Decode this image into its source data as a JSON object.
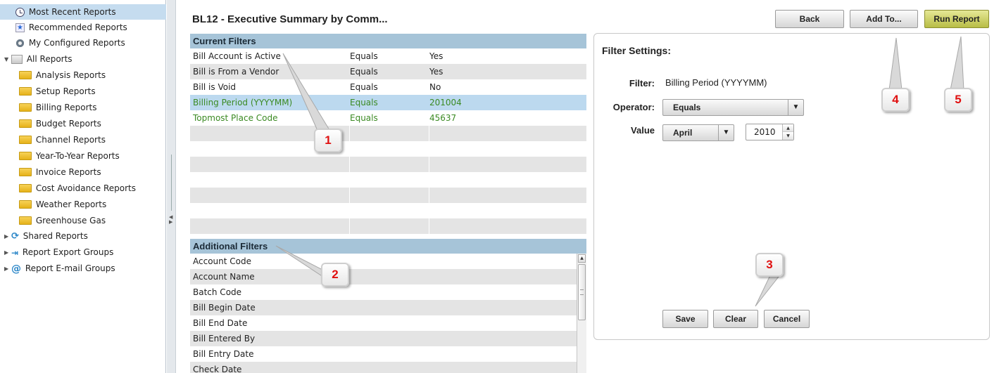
{
  "sidebar": {
    "items": [
      {
        "label": "Most Recent Reports",
        "icon": "clock-icon"
      },
      {
        "label": "Recommended Reports",
        "icon": "star-icon"
      },
      {
        "label": "My Configured Reports",
        "icon": "gear-icon"
      },
      {
        "label": "All Reports",
        "icon": "all-reports-icon"
      },
      {
        "label": "Analysis Reports",
        "icon": "folder-icon"
      },
      {
        "label": "Setup Reports",
        "icon": "folder-icon"
      },
      {
        "label": "Billing Reports",
        "icon": "folder-icon"
      },
      {
        "label": "Budget Reports",
        "icon": "folder-icon"
      },
      {
        "label": "Channel Reports",
        "icon": "folder-icon"
      },
      {
        "label": "Year-To-Year Reports",
        "icon": "folder-icon"
      },
      {
        "label": "Invoice Reports",
        "icon": "folder-icon"
      },
      {
        "label": "Cost Avoidance Reports",
        "icon": "folder-icon"
      },
      {
        "label": "Weather Reports",
        "icon": "folder-icon"
      },
      {
        "label": "Greenhouse Gas",
        "icon": "folder-icon"
      },
      {
        "label": "Shared Reports",
        "icon": "share-icon"
      },
      {
        "label": "Report Export Groups",
        "icon": "export-icon"
      },
      {
        "label": "Report E-mail Groups",
        "icon": "email-at-icon"
      }
    ]
  },
  "header": {
    "title": "BL12 - Executive Summary by Comm...",
    "back_label": "Back",
    "add_to_label": "Add To...",
    "run_report_label": "Run Report"
  },
  "current_filters": {
    "heading": "Current Filters",
    "rows": [
      {
        "field": "Bill Account is Active",
        "operator": "Equals",
        "value": "Yes"
      },
      {
        "field": "Bill is From a Vendor",
        "operator": "Equals",
        "value": "Yes"
      },
      {
        "field": "Bill is Void",
        "operator": "Equals",
        "value": "No"
      },
      {
        "field": "Billing Period (YYYYMM)",
        "operator": "Equals",
        "value": "201004"
      },
      {
        "field": "Topmost Place Code",
        "operator": "Equals",
        "value": "45637"
      }
    ]
  },
  "additional_filters": {
    "heading": "Additional Filters",
    "items": [
      "Account Code",
      "Account Name",
      "Batch Code",
      "Bill Begin Date",
      "Bill End Date",
      "Bill Entered By",
      "Bill Entry Date",
      "Check Date"
    ]
  },
  "filter_settings": {
    "title": "Filter Settings:",
    "filter_label": "Filter:",
    "filter_value": "Billing Period (YYYYMM)",
    "operator_label": "Operator:",
    "operator_value": "Equals",
    "value_label": "Value",
    "month_value": "April",
    "year_value": "2010",
    "save_label": "Save",
    "clear_label": "Clear",
    "cancel_label": "Cancel"
  },
  "callouts": [
    "1",
    "2",
    "3",
    "4",
    "5"
  ],
  "colors": {
    "section_header": "#a6c4d8",
    "selected_row": "#bcd9ef",
    "highlight_text": "#3b8a23",
    "callout_number": "#e01010",
    "run_button": "#c9cd5e"
  }
}
